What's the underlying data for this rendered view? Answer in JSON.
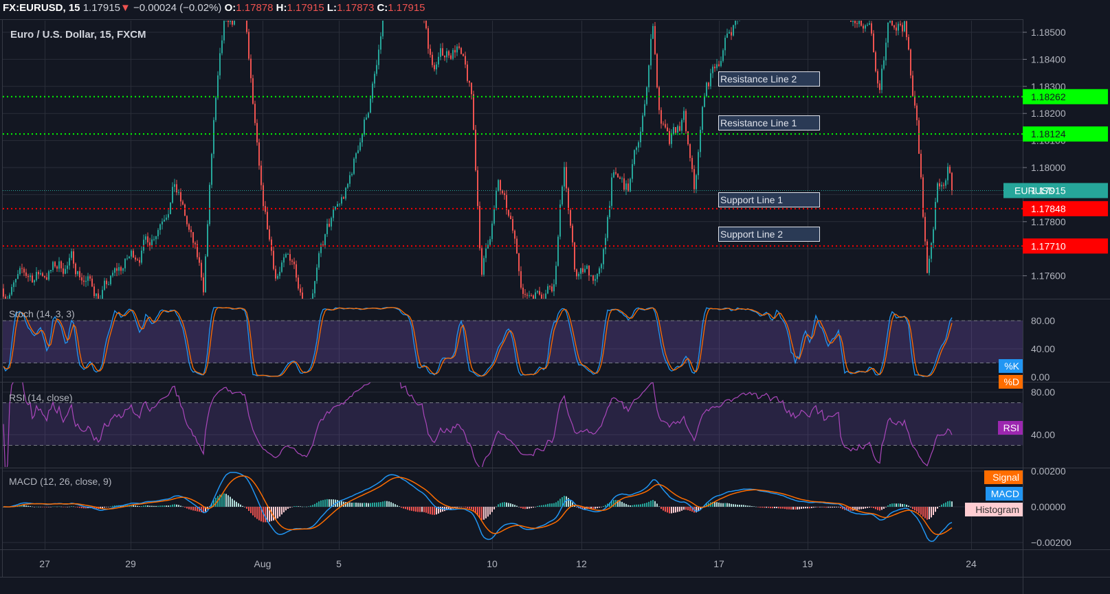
{
  "header": {
    "symbol": "FX:EURUSD, 15",
    "last": "1.17915",
    "change": "−0.00024 (−0.02%)",
    "o_label": "O:",
    "o": "1.17878",
    "h_label": "H:",
    "h": "1.17915",
    "l_label": "L:",
    "l": "1.17873",
    "c_label": "C:",
    "c": "1.17915",
    "down_arrow": "▼"
  },
  "main_pane": {
    "title": "Euro / U.S. Dollar, 15, FXCM",
    "price_ticks": [
      "1.18500",
      "1.18400",
      "1.18300",
      "1.18200",
      "1.18100",
      "1.18000",
      "1.17900",
      "1.17800",
      "1.17700",
      "1.17600"
    ],
    "current": {
      "symbol": "EURUSD",
      "price": "1.17915",
      "value": 1.17915
    },
    "levels": [
      {
        "label": "Resistance Line 2",
        "price": "1.18262",
        "value": 1.18262,
        "kind": "resistance"
      },
      {
        "label": "Resistance Line 1",
        "price": "1.18124",
        "value": 1.18124,
        "kind": "resistance"
      },
      {
        "label": "Support Line 1",
        "price": "1.17848",
        "value": 1.17848,
        "kind": "support"
      },
      {
        "label": "Support Line 2",
        "price": "1.17710",
        "value": 1.1771,
        "kind": "support"
      }
    ]
  },
  "stoch_pane": {
    "title": "Stoch (14, 3, 3)",
    "ticks": [
      "80.00",
      "40.00",
      "0.00"
    ],
    "k_label": "%K",
    "d_label": "%D"
  },
  "rsi_pane": {
    "title": "RSI (14, close)",
    "ticks": [
      "80.00",
      "40.00"
    ],
    "rsi_label": "RSI"
  },
  "macd_pane": {
    "title": "MACD (12, 26, close, 9)",
    "ticks": [
      "0.00200",
      "0.00000",
      "−0.00200"
    ],
    "signal_label": "Signal",
    "macd_label": "MACD",
    "hist_label": "Histogram"
  },
  "time_axis": [
    "27",
    "29",
    "Aug",
    "5",
    "10",
    "12",
    "17",
    "19",
    "24"
  ],
  "colors": {
    "bg": "#131722",
    "up": "#26a69a",
    "down": "#ef5350",
    "resistance": "#00ff00",
    "support": "#ff0000",
    "k": "#2196f3",
    "d": "#ff6d00",
    "rsi": "#ab47bc"
  },
  "chart_data": {
    "type": "candlestick",
    "interval": "15",
    "bars": 461,
    "price_range": [
      1.17514,
      1.18543
    ],
    "waypoints_bar_price": [
      [
        0,
        1.17553
      ],
      [
        33,
        1.17654
      ],
      [
        47,
        1.17527
      ],
      [
        72,
        1.17756
      ],
      [
        83,
        1.17959
      ],
      [
        97,
        1.17553
      ],
      [
        102,
        1.18162
      ],
      [
        107,
        1.18492
      ],
      [
        117,
        1.18543
      ],
      [
        120,
        1.18289
      ],
      [
        125,
        1.17857
      ],
      [
        132,
        1.17603
      ],
      [
        140,
        1.17654
      ],
      [
        147,
        1.17527
      ],
      [
        157,
        1.17756
      ],
      [
        167,
        1.17908
      ],
      [
        173,
        1.18111
      ],
      [
        182,
        1.18391
      ],
      [
        185,
        1.186
      ],
      [
        203,
        1.186
      ],
      [
        208,
        1.18365
      ],
      [
        220,
        1.18467
      ],
      [
        227,
        1.18238
      ],
      [
        232,
        1.17603
      ],
      [
        240,
        1.17934
      ],
      [
        247,
        1.1773
      ],
      [
        253,
        1.17527
      ],
      [
        267,
        1.17603
      ],
      [
        272,
        1.18035
      ],
      [
        277,
        1.17603
      ],
      [
        290,
        1.17603
      ],
      [
        295,
        1.17959
      ],
      [
        303,
        1.17908
      ],
      [
        310,
        1.18162
      ],
      [
        315,
        1.18543
      ],
      [
        318,
        1.18213
      ],
      [
        323,
        1.1806
      ],
      [
        330,
        1.18162
      ],
      [
        335,
        1.17883
      ],
      [
        340,
        1.18264
      ],
      [
        350,
        1.18467
      ],
      [
        358,
        1.186
      ],
      [
        365,
        1.187
      ],
      [
        405,
        1.187
      ],
      [
        408,
        1.18543
      ],
      [
        420,
        1.18467
      ],
      [
        425,
        1.18238
      ],
      [
        430,
        1.18543
      ],
      [
        437,
        1.18543
      ],
      [
        443,
        1.18162
      ],
      [
        448,
        1.17603
      ],
      [
        453,
        1.17934
      ],
      [
        458,
        1.1801
      ],
      [
        460,
        1.17915
      ]
    ],
    "indicators": {
      "stoch": [
        14,
        3,
        3
      ],
      "rsi": 14,
      "macd": [
        12,
        26,
        9
      ]
    },
    "stoch_range": [
      0,
      100
    ],
    "rsi_range": [
      8,
      89
    ],
    "macd_range": [
      -0.00228,
      0.002
    ]
  }
}
